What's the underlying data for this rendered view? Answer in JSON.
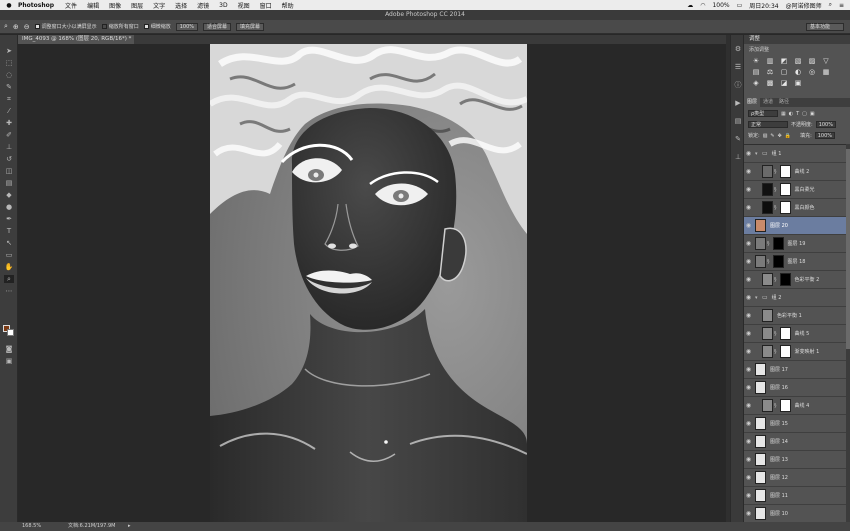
{
  "menubar": {
    "apple": "",
    "app_name": "Photoshop",
    "items": [
      "文件",
      "编辑",
      "图像",
      "图层",
      "文字",
      "选择",
      "滤镜",
      "3D",
      "视图",
      "窗口",
      "帮助"
    ],
    "battery": "100%",
    "clock": "周日20:34",
    "user": "@阿诺修图师"
  },
  "window": {
    "title": "Adobe Photoshop CC 2014"
  },
  "options_bar": {
    "check_resize_windows": "调整窗口大小以满屏显示",
    "check_zoom_all": "缩放所有窗口",
    "check_scrubby_zoom": "细微缩放",
    "zoom_value": "100%",
    "fit_screen": "适合屏幕",
    "fill_screen": "填充屏幕",
    "workspace": "基本功能"
  },
  "document": {
    "tab_title": "IMG_4093 @ 168% (图层 20, RGB/16*) *"
  },
  "status": {
    "zoom": "168.5%",
    "doc_size": "文档:6.21M/197.9M"
  },
  "adjustments": {
    "header": "调整",
    "subtitle": "添加调整",
    "icons": [
      "☀",
      "▥",
      "◩",
      "▧",
      "▨",
      "▽",
      "▤",
      "⚖",
      "▢",
      "◐",
      "◎",
      "▦",
      "◈",
      "▩",
      "◪",
      "▣"
    ]
  },
  "layers_panel": {
    "tabs": [
      "图层",
      "通道",
      "路径"
    ],
    "filter_label": "ρ类型",
    "blend_mode": "正常",
    "opacity_label": "不透明度:",
    "opacity_value": "100%",
    "lock_label": "锁定:",
    "fill_label": "填充:",
    "fill_value": "100%",
    "layers": [
      {
        "name": "组 1",
        "kind": "group",
        "selected": false,
        "thumb": "",
        "mask": ""
      },
      {
        "name": "曲线 2",
        "kind": "adjust",
        "selected": false,
        "thumb": "#6a6a6a",
        "mask": "#ffffff"
      },
      {
        "name": "黑白柔光",
        "kind": "adjust",
        "selected": false,
        "thumb": "#111111",
        "mask": "#ffffff"
      },
      {
        "name": "黑白颜色",
        "kind": "adjust",
        "selected": false,
        "thumb": "#0d0d0d",
        "mask": "#ffffff"
      },
      {
        "name": "图层 20",
        "kind": "pixel",
        "selected": true,
        "thumb": "#c98a6a",
        "mask": ""
      },
      {
        "name": "图层 19",
        "kind": "pixel",
        "selected": false,
        "thumb": "#7a7a7a",
        "mask": "#000000"
      },
      {
        "name": "图层 18",
        "kind": "pixel",
        "selected": false,
        "thumb": "#7a7a7a",
        "mask": "#000000"
      },
      {
        "name": "色彩平衡 2",
        "kind": "adjust",
        "selected": false,
        "thumb": "#8a8a8a",
        "mask": "#000000"
      },
      {
        "name": "组 2",
        "kind": "group",
        "selected": false,
        "thumb": "",
        "mask": ""
      },
      {
        "name": "色彩平衡 1",
        "kind": "adjust",
        "selected": false,
        "thumb": "#8a8a8a",
        "mask": ""
      },
      {
        "name": "曲线 5",
        "kind": "adjust",
        "selected": false,
        "thumb": "#8a8a8a",
        "mask": "#ffffff"
      },
      {
        "name": "渐变映射 1",
        "kind": "adjust",
        "selected": false,
        "thumb": "#8a8a8a",
        "mask": "#ffffff"
      },
      {
        "name": "图层 17",
        "kind": "pixel",
        "selected": false,
        "thumb": "#e6e6e6",
        "mask": ""
      },
      {
        "name": "图层 16",
        "kind": "pixel",
        "selected": false,
        "thumb": "#e6e6e6",
        "mask": ""
      },
      {
        "name": "曲线 4",
        "kind": "adjust",
        "selected": false,
        "thumb": "#8a8a8a",
        "mask": "#ffffff"
      },
      {
        "name": "图层 15",
        "kind": "pixel",
        "selected": false,
        "thumb": "#e6e6e6",
        "mask": ""
      },
      {
        "name": "图层 14",
        "kind": "pixel",
        "selected": false,
        "thumb": "#e6e6e6",
        "mask": ""
      },
      {
        "name": "图层 13",
        "kind": "pixel",
        "selected": false,
        "thumb": "#e6e6e6",
        "mask": ""
      },
      {
        "name": "图层 12",
        "kind": "pixel",
        "selected": false,
        "thumb": "#e6e6e6",
        "mask": ""
      },
      {
        "name": "图层 11",
        "kind": "pixel",
        "selected": false,
        "thumb": "#e6e6e6",
        "mask": ""
      },
      {
        "name": "图层 10",
        "kind": "pixel",
        "selected": false,
        "thumb": "#e6e6e6",
        "mask": ""
      },
      {
        "name": "图层 9",
        "kind": "pixel",
        "selected": false,
        "thumb": "#e6e6e6",
        "mask": ""
      }
    ]
  },
  "colors": {
    "foreground": "#7c3a14",
    "background": "#ffffff",
    "selection": "#6b7da0"
  }
}
